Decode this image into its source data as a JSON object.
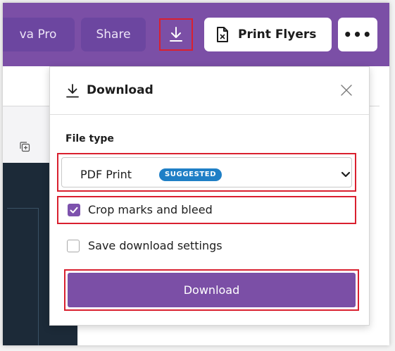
{
  "topbar": {
    "canva_pro_label": "va Pro",
    "share_label": "Share",
    "download_icon": "download-icon",
    "print_flyers_label": "Print Flyers",
    "print_flyers_icon": "print-icon",
    "more_label": "•••",
    "bar_color": "#7b4fa6"
  },
  "panel": {
    "title": "Download",
    "file_type_label": "File type",
    "file_type_value": "PDF Print",
    "file_type_badge": "SUGGESTED",
    "crop_marks_label": "Crop marks and bleed",
    "crop_marks_checked": true,
    "save_settings_label": "Save download settings",
    "save_settings_checked": false,
    "download_button_label": "Download",
    "accent_color": "#7d52ad",
    "badge_color": "#1f7fc6",
    "highlight_color": "#d9202f"
  }
}
